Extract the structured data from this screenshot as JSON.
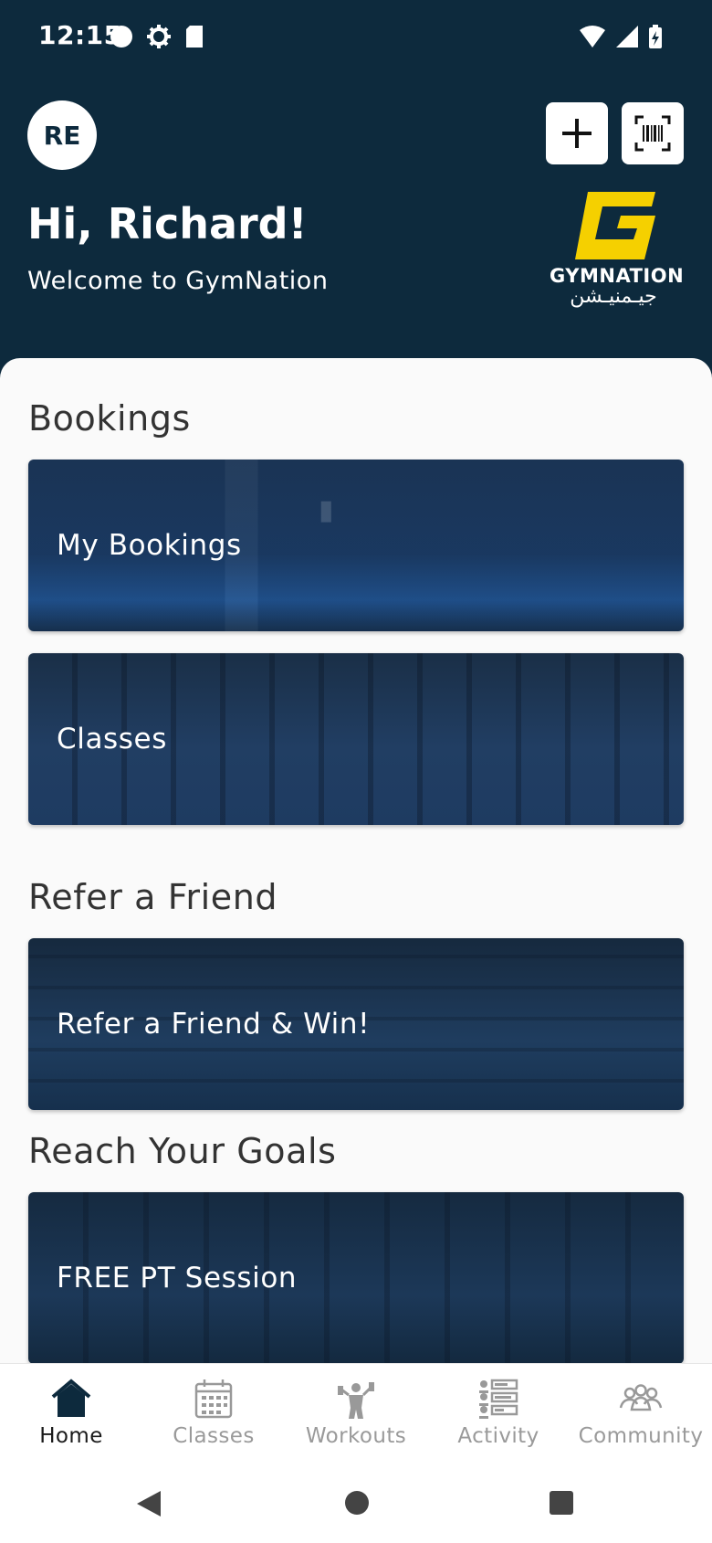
{
  "status": {
    "time": "12:15"
  },
  "header": {
    "avatar_initials": "RE",
    "greeting": "Hi, Richard!",
    "welcome": "Welcome to GymNation",
    "logo_en": "GYMNATION",
    "logo_ar": "جيـمنيـشن",
    "logo_color": "#f5d000"
  },
  "sections": {
    "bookings_title": "Bookings",
    "my_bookings": "My Bookings",
    "classes": "Classes",
    "refer_title": "Refer a Friend",
    "refer_card": "Refer a Friend & Win!",
    "goals_title": "Reach Your Goals",
    "pt_card": "FREE PT Session"
  },
  "nav": {
    "items": [
      {
        "label": "Home",
        "icon": "home-icon",
        "active": true
      },
      {
        "label": "Classes",
        "icon": "calendar-icon",
        "active": false
      },
      {
        "label": "Workouts",
        "icon": "workout-icon",
        "active": false
      },
      {
        "label": "Activity",
        "icon": "activity-list-icon",
        "active": false
      },
      {
        "label": "Community",
        "icon": "community-icon",
        "active": false
      }
    ]
  },
  "colors": {
    "brand_dark": "#0d2a3d",
    "accent": "#f5d000"
  }
}
